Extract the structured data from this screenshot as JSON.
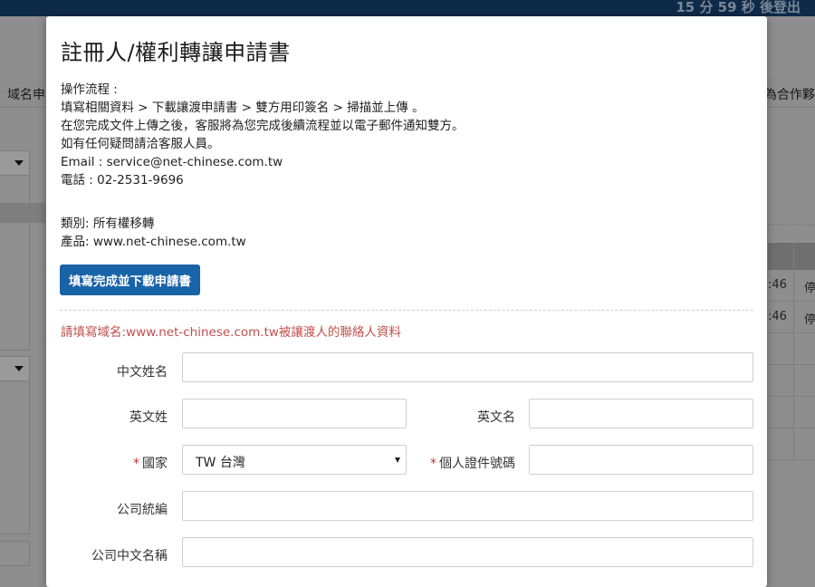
{
  "background": {
    "timer_text": "15 分 59 秒 後登出",
    "nav_left": "域名申",
    "nav_right": "為合作夥",
    "table_rows": [
      {
        "time": ":46",
        "status": "停"
      },
      {
        "time": ":46",
        "status": "停"
      }
    ]
  },
  "modal": {
    "title": "註冊人/權利轉讓申請書",
    "instructions": {
      "heading": "操作流程 :",
      "steps": "填寫相關資料 > 下載讓渡申請書 > 雙方用印簽名 > 掃描並上傳 。",
      "after_upload": "在您完成文件上傳之後，客服將為您完成後續流程並以電子郵件通知雙方。",
      "contact_note": "如有任何疑問請洽客服人員。",
      "email": "Email : service@net-chinese.com.tw",
      "phone": "電話 : 02-2531-9696"
    },
    "category": "類別: 所有權移轉",
    "product": "產品: www.net-chinese.com.tw",
    "download_button": "填寫完成並下載申請書",
    "section_title": "請填寫域名:www.net-chinese.com.tw被讓渡人的聯絡人資料",
    "form": {
      "chinese_name_label": "中文姓名",
      "english_surname_label": "英文姓",
      "english_given_name_label": "英文名",
      "country_label": "國家",
      "country_value": "TW 台灣",
      "id_number_label": "個人證件號碼",
      "company_tax_id_label": "公司統編",
      "company_chinese_name_label": "公司中文名稱",
      "required_mark": "*"
    }
  },
  "colors": {
    "primary_button": "#1963a7",
    "section_title": "#c0504d",
    "required": "#c9302c",
    "topbar": "#0d2a49"
  }
}
